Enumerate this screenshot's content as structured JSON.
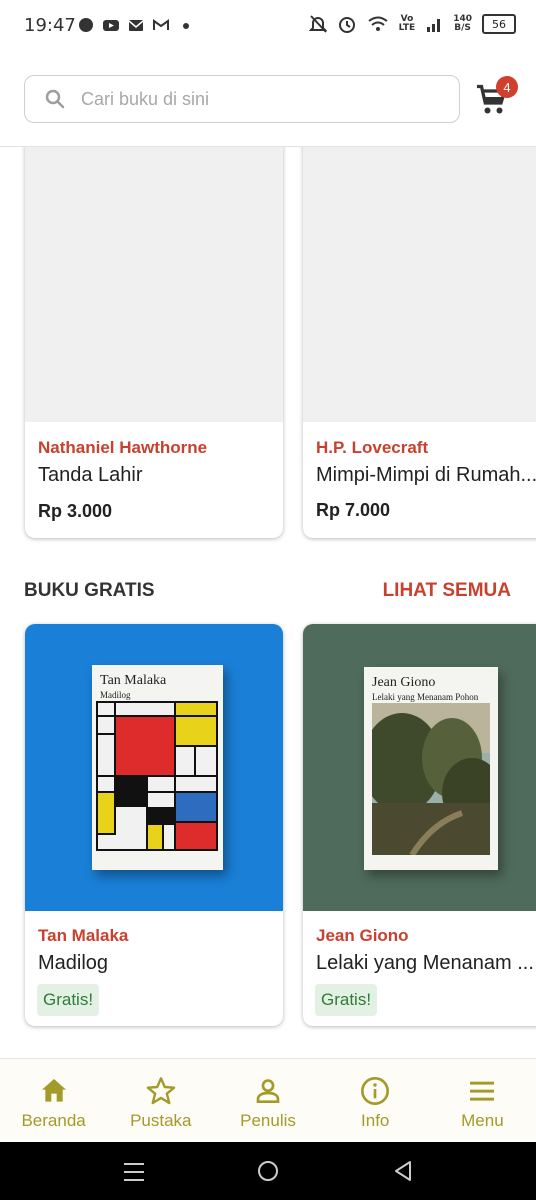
{
  "status_bar": {
    "time": "19:47",
    "net_speed_top": "140",
    "net_speed_bottom": "B/S",
    "lte_top": "Vo",
    "lte_bottom": "LTE",
    "battery": "56"
  },
  "header": {
    "search_placeholder": "Cari buku di sini",
    "cart_count": "4"
  },
  "top_books": [
    {
      "author": "Nathaniel Hawthorne",
      "title": "Tanda Lahir",
      "price": "Rp 3.000"
    },
    {
      "author": "H.P. Lovecraft",
      "title": "Mimpi-Mimpi di Rumah...",
      "price": "Rp 7.000"
    }
  ],
  "free_section": {
    "title": "BUKU GRATIS",
    "see_all": "LIHAT SEMUA",
    "books": [
      {
        "author": "Tan Malaka",
        "title": "Madilog",
        "badge": "Gratis!",
        "cover_author": "Tan Malaka",
        "cover_title": "Madilog",
        "bg": "#1a7fd6"
      },
      {
        "author": "Jean Giono",
        "title": "Lelaki yang Menanam ...",
        "badge": "Gratis!",
        "cover_author": "Jean Giono",
        "cover_title": "Lelaki yang Menanam Pohon",
        "bg": "#4f6b5b"
      }
    ]
  },
  "bottom_nav": [
    {
      "label": "Beranda",
      "icon": "home-icon"
    },
    {
      "label": "Pustaka",
      "icon": "star-icon"
    },
    {
      "label": "Penulis",
      "icon": "person-icon"
    },
    {
      "label": "Info",
      "icon": "info-icon"
    },
    {
      "label": "Menu",
      "icon": "menu-icon"
    }
  ],
  "colors": {
    "accent": "#c9412e",
    "nav": "#a49a2a",
    "free": "#2e7d32"
  }
}
